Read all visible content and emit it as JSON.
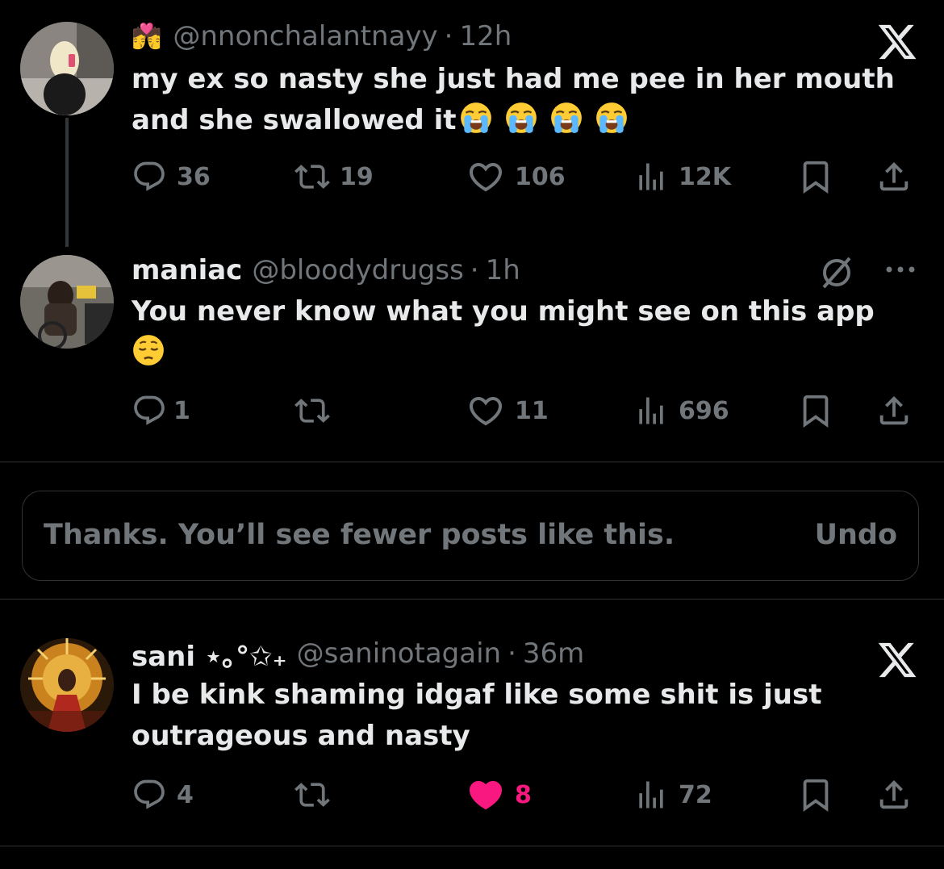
{
  "posts": [
    {
      "name_emoji": "💏",
      "handle": "@nnonchalantnayy",
      "sep": "·",
      "time": "12h",
      "text": "my ex so nasty she just had me pee in her mouth and she swallowed it",
      "stats": {
        "replies": "36",
        "reposts": "19",
        "likes": "106",
        "views": "12K"
      }
    },
    {
      "name": "maniac",
      "handle": "@bloodydrugss",
      "sep": "·",
      "time": "1h",
      "text": "You never know what you might see on this app",
      "stats": {
        "replies": "1",
        "reposts": "",
        "likes": "11",
        "views": "696"
      }
    },
    {
      "name": "sani ⋆｡°✩₊",
      "handle": "@saninotagain",
      "sep": "·",
      "time": "36m",
      "text": "I be kink shaming idgaf like some shit is just outrageous and nasty",
      "stats": {
        "replies": "4",
        "reposts": "",
        "likes": "8",
        "views": "72"
      },
      "liked": true
    }
  ],
  "notice": {
    "text": "Thanks. You’ll see fewer posts like this.",
    "undo_label": "Undo"
  },
  "colors": {
    "background": "#000000",
    "text_primary": "#e7e9ea",
    "text_secondary": "#71767b",
    "like_active": "#f91880",
    "divider": "#2f3336"
  },
  "icons": [
    "reply-icon",
    "repost-icon",
    "like-icon",
    "views-icon",
    "bookmark-icon",
    "share-icon",
    "close-x-icon",
    "grok-icon",
    "more-icon",
    "loudly-crying-face-emoji",
    "pensive-face-emoji"
  ]
}
